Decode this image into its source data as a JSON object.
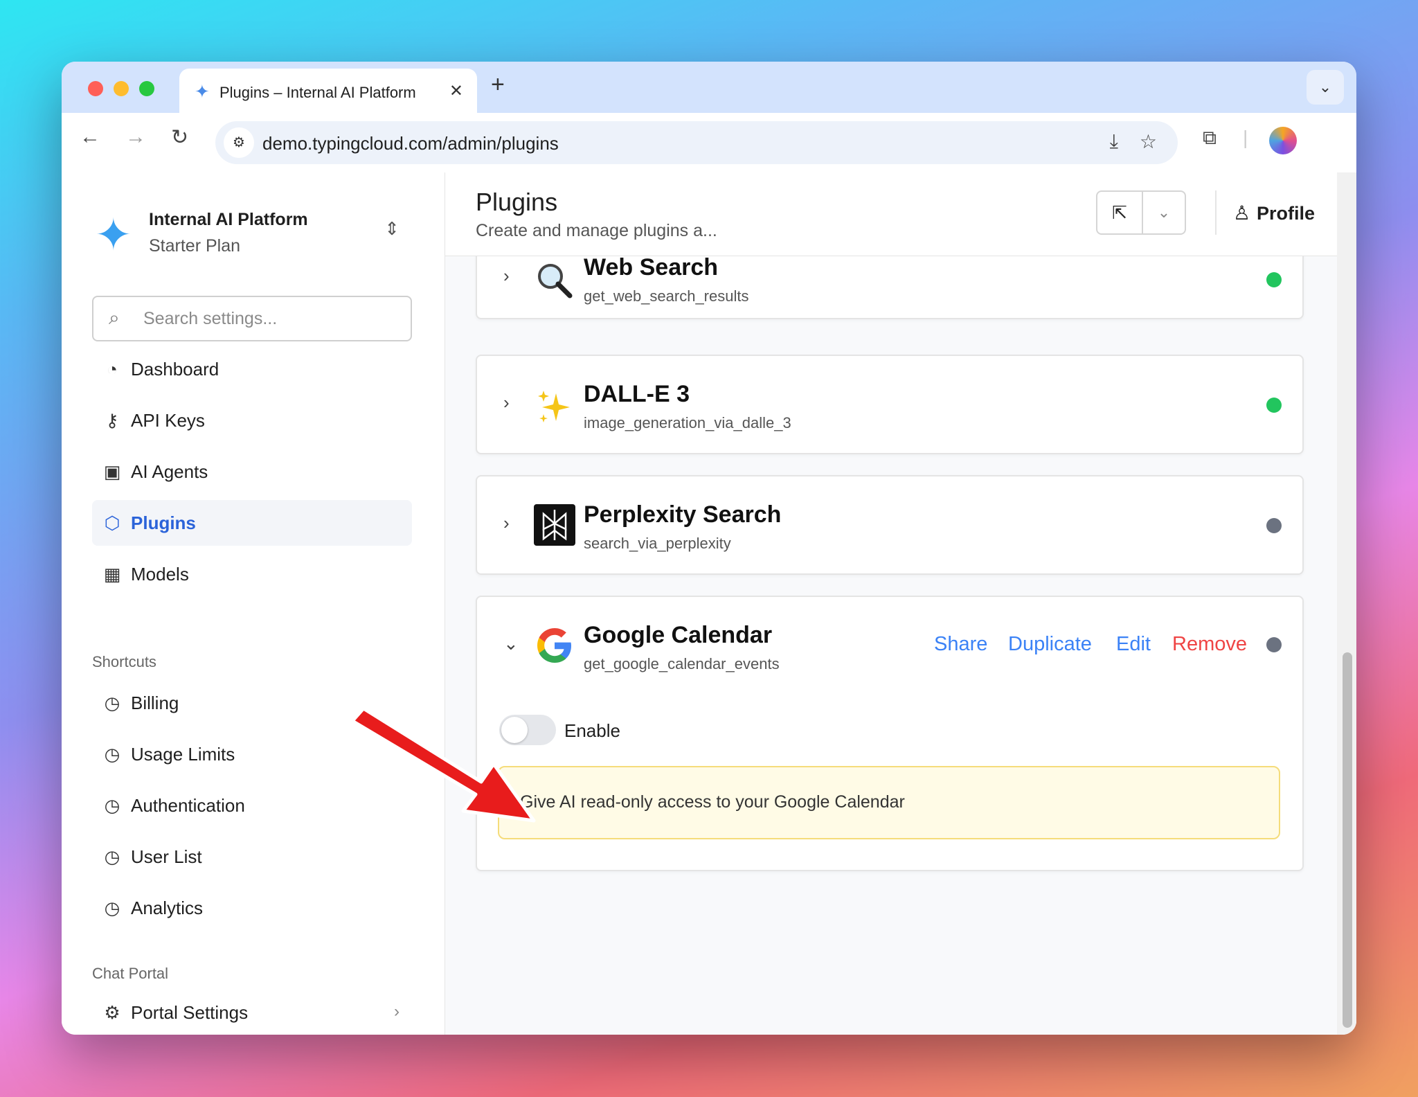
{
  "browser": {
    "tab_title": "Plugins – Internal AI Platform",
    "url": "demo.typingcloud.com/admin/plugins",
    "new_tab": "+",
    "close_tab": "✕"
  },
  "sidebar": {
    "org_name": "Internal AI Platform",
    "org_plan": "Starter Plan",
    "search_placeholder": "Search settings...",
    "nav": [
      {
        "label": "Dashboard",
        "icon": "pie-chart-icon"
      },
      {
        "label": "API Keys",
        "icon": "key-icon"
      },
      {
        "label": "AI Agents",
        "icon": "agent-icon"
      },
      {
        "label": "Plugins",
        "icon": "puzzle-icon"
      },
      {
        "label": "Models",
        "icon": "chip-icon"
      }
    ],
    "shortcuts_title": "Shortcuts",
    "shortcuts": [
      {
        "label": "Billing",
        "icon": "clock-icon"
      },
      {
        "label": "Usage Limits",
        "icon": "clock-icon"
      },
      {
        "label": "Authentication",
        "icon": "clock-icon"
      },
      {
        "label": "User List",
        "icon": "clock-icon"
      },
      {
        "label": "Analytics",
        "icon": "clock-icon"
      }
    ],
    "portal_title": "Chat Portal",
    "portal_settings": "Portal Settings"
  },
  "header": {
    "title": "Plugins",
    "subtitle": "Create and manage plugins a...",
    "profile": "Profile"
  },
  "plugins": [
    {
      "name": "Web Search",
      "function": "get_web_search_results",
      "status_color": "#22c55e",
      "icon": "magnifier-icon"
    },
    {
      "name": "DALL-E 3",
      "function": "image_generation_via_dalle_3",
      "status_color": "#22c55e",
      "icon": "sparkles-icon"
    },
    {
      "name": "Perplexity Search",
      "function": "search_via_perplexity",
      "status_color": "#6b7280",
      "icon": "perplexity-logo-icon"
    },
    {
      "name": "Google Calendar",
      "function": "get_google_calendar_events",
      "status_color": "#6b7280",
      "icon": "google-logo-icon",
      "actions": {
        "share": "Share",
        "duplicate": "Duplicate",
        "edit": "Edit",
        "remove": "Remove"
      },
      "enable_label": "Enable",
      "description": "Give AI read-only access to your Google Calendar"
    }
  ],
  "colors": {
    "accent": "#2b63d9",
    "link": "#3b82f6",
    "danger": "#ef4444",
    "arrow": "#e81c1c"
  }
}
